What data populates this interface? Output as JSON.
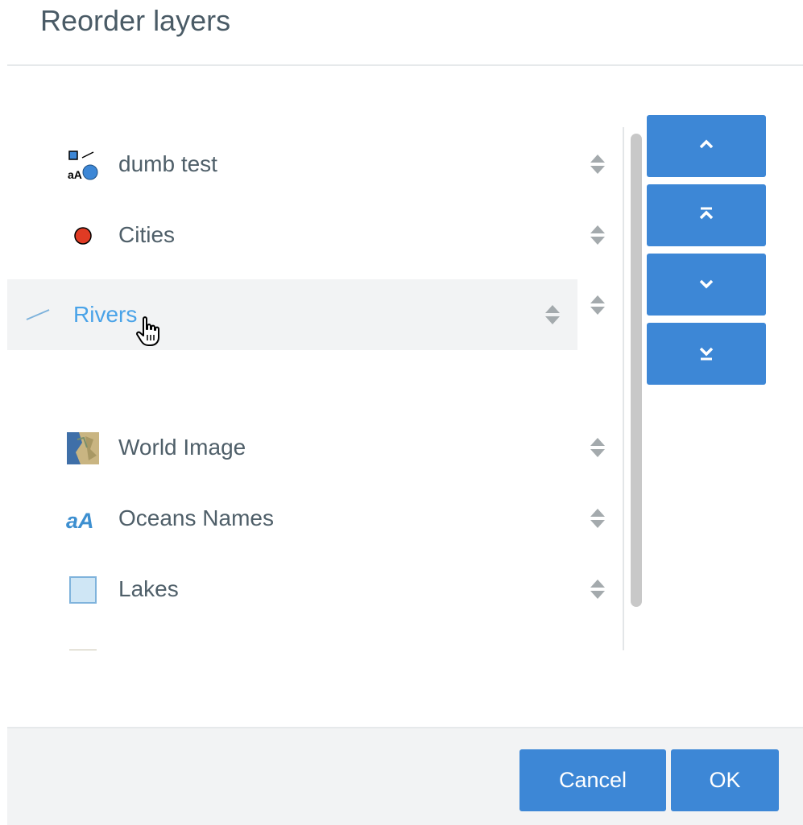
{
  "dialog": {
    "title": "Reorder layers"
  },
  "layers": [
    {
      "label": "dumb test",
      "icon": "mixed-symbol-icon",
      "state": "normal"
    },
    {
      "label": "Cities",
      "icon": "red-point-icon",
      "state": "normal"
    },
    {
      "label": "Rivers",
      "icon": "line-symbol-icon",
      "state": "dragging"
    },
    {
      "label": "World Image",
      "icon": "raster-image-icon",
      "state": "normal"
    },
    {
      "label": "Oceans Names",
      "icon": "label-text-icon",
      "state": "normal"
    },
    {
      "label": "Lakes",
      "icon": "polygon-fill-icon",
      "state": "normal"
    }
  ],
  "move_buttons": [
    {
      "action": "move-up",
      "icon": "chevron-up-icon"
    },
    {
      "action": "move-to-top",
      "icon": "move-to-top-icon"
    },
    {
      "action": "move-down",
      "icon": "chevron-down-icon"
    },
    {
      "action": "move-to-bottom",
      "icon": "move-to-bottom-icon"
    }
  ],
  "footer": {
    "cancel_label": "Cancel",
    "ok_label": "OK"
  },
  "colors": {
    "accent": "#3d87d6",
    "dragging_text": "#4aa3e8",
    "text": "#4f5f69",
    "title": "#4a5b66",
    "city_point": "#e03b24",
    "lake_fill": "#cfe6f5"
  }
}
